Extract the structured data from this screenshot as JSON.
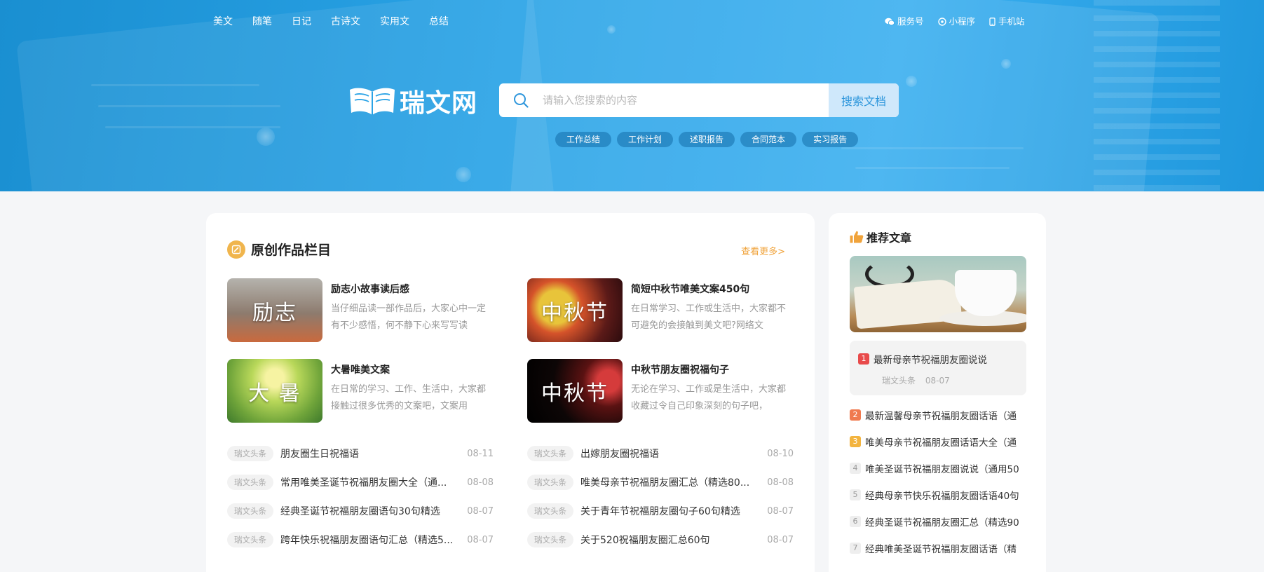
{
  "topnav": [
    "美文",
    "随笔",
    "日记",
    "古诗文",
    "实用文",
    "总结"
  ],
  "toplinks": [
    {
      "icon": "wechat-icon",
      "label": "服务号"
    },
    {
      "icon": "miniprogram-icon",
      "label": "小程序"
    },
    {
      "icon": "mobile-icon",
      "label": "手机站"
    }
  ],
  "logo": {
    "text": "瑞文网"
  },
  "search": {
    "placeholder": "请输入您搜索的内容",
    "button": "搜索文档"
  },
  "tags": [
    "工作总结",
    "工作计划",
    "述职报告",
    "合同范本",
    "实习报告"
  ],
  "original": {
    "title": "原创作品栏目",
    "more": "查看更多>",
    "featured": [
      {
        "thumb_text": "励志",
        "title": "励志小故事读后感",
        "desc": "当仔细品读一部作品后，大家心中一定有不少感悟，何不静下心来写写读"
      },
      {
        "thumb_text": "中秋节",
        "title": "简短中秋节唯美文案450句",
        "desc": "在日常学习、工作或生活中，大家都不可避免的会接触到美文吧?网络文"
      },
      {
        "thumb_text": "大 暑",
        "title": "大暑唯美文案",
        "desc": "在日常的学习、工作、生活中，大家都接触过很多优秀的文案吧，文案用"
      },
      {
        "thumb_text": "中秋节",
        "title": "中秋节朋友圈祝福句子",
        "desc": "无论在学习、工作或是生活中，大家都收藏过令自己印象深刻的句子吧，"
      }
    ],
    "badge": "瑞文头条",
    "list_left": [
      {
        "title": "朋友圈生日祝福语",
        "date": "08-11"
      },
      {
        "title": "常用唯美圣诞节祝福朋友圈大全（通...",
        "date": "08-08"
      },
      {
        "title": "经典圣诞节祝福朋友圈语句30句精选",
        "date": "08-07"
      },
      {
        "title": "跨年快乐祝福朋友圈语句汇总（精选5...",
        "date": "08-07"
      }
    ],
    "list_right": [
      {
        "title": "出嫁朋友圈祝福语",
        "date": "08-10"
      },
      {
        "title": "唯美母亲节祝福朋友圈汇总（精选80...",
        "date": "08-08"
      },
      {
        "title": "关于青年节祝福朋友圈句子60句精选",
        "date": "08-07"
      },
      {
        "title": "关于520祝福朋友圈汇总60句",
        "date": "08-07"
      }
    ]
  },
  "recommend": {
    "title": "推荐文章",
    "top": {
      "num": "1",
      "title": "最新母亲节祝福朋友圈说说",
      "source": "瑞文头条",
      "date": "08-07"
    },
    "items": [
      {
        "num": "2",
        "title": "最新温馨母亲节祝福朋友圈话语（通"
      },
      {
        "num": "3",
        "title": "唯美母亲节祝福朋友圈话语大全（通"
      },
      {
        "num": "4",
        "title": "唯美圣诞节祝福朋友圈说说（通用50"
      },
      {
        "num": "5",
        "title": "经典母亲节快乐祝福朋友圈话语40句"
      },
      {
        "num": "6",
        "title": "经典圣诞节祝福朋友圈汇总（精选90"
      },
      {
        "num": "7",
        "title": "经典唯美圣诞节祝福朋友圈话语（精"
      }
    ]
  },
  "colors": {
    "hero": "#1f97dc",
    "accent": "#f0a33b",
    "rank1": "#e84a4a",
    "rank2": "#f07a4f",
    "rank3": "#f3b43f"
  }
}
